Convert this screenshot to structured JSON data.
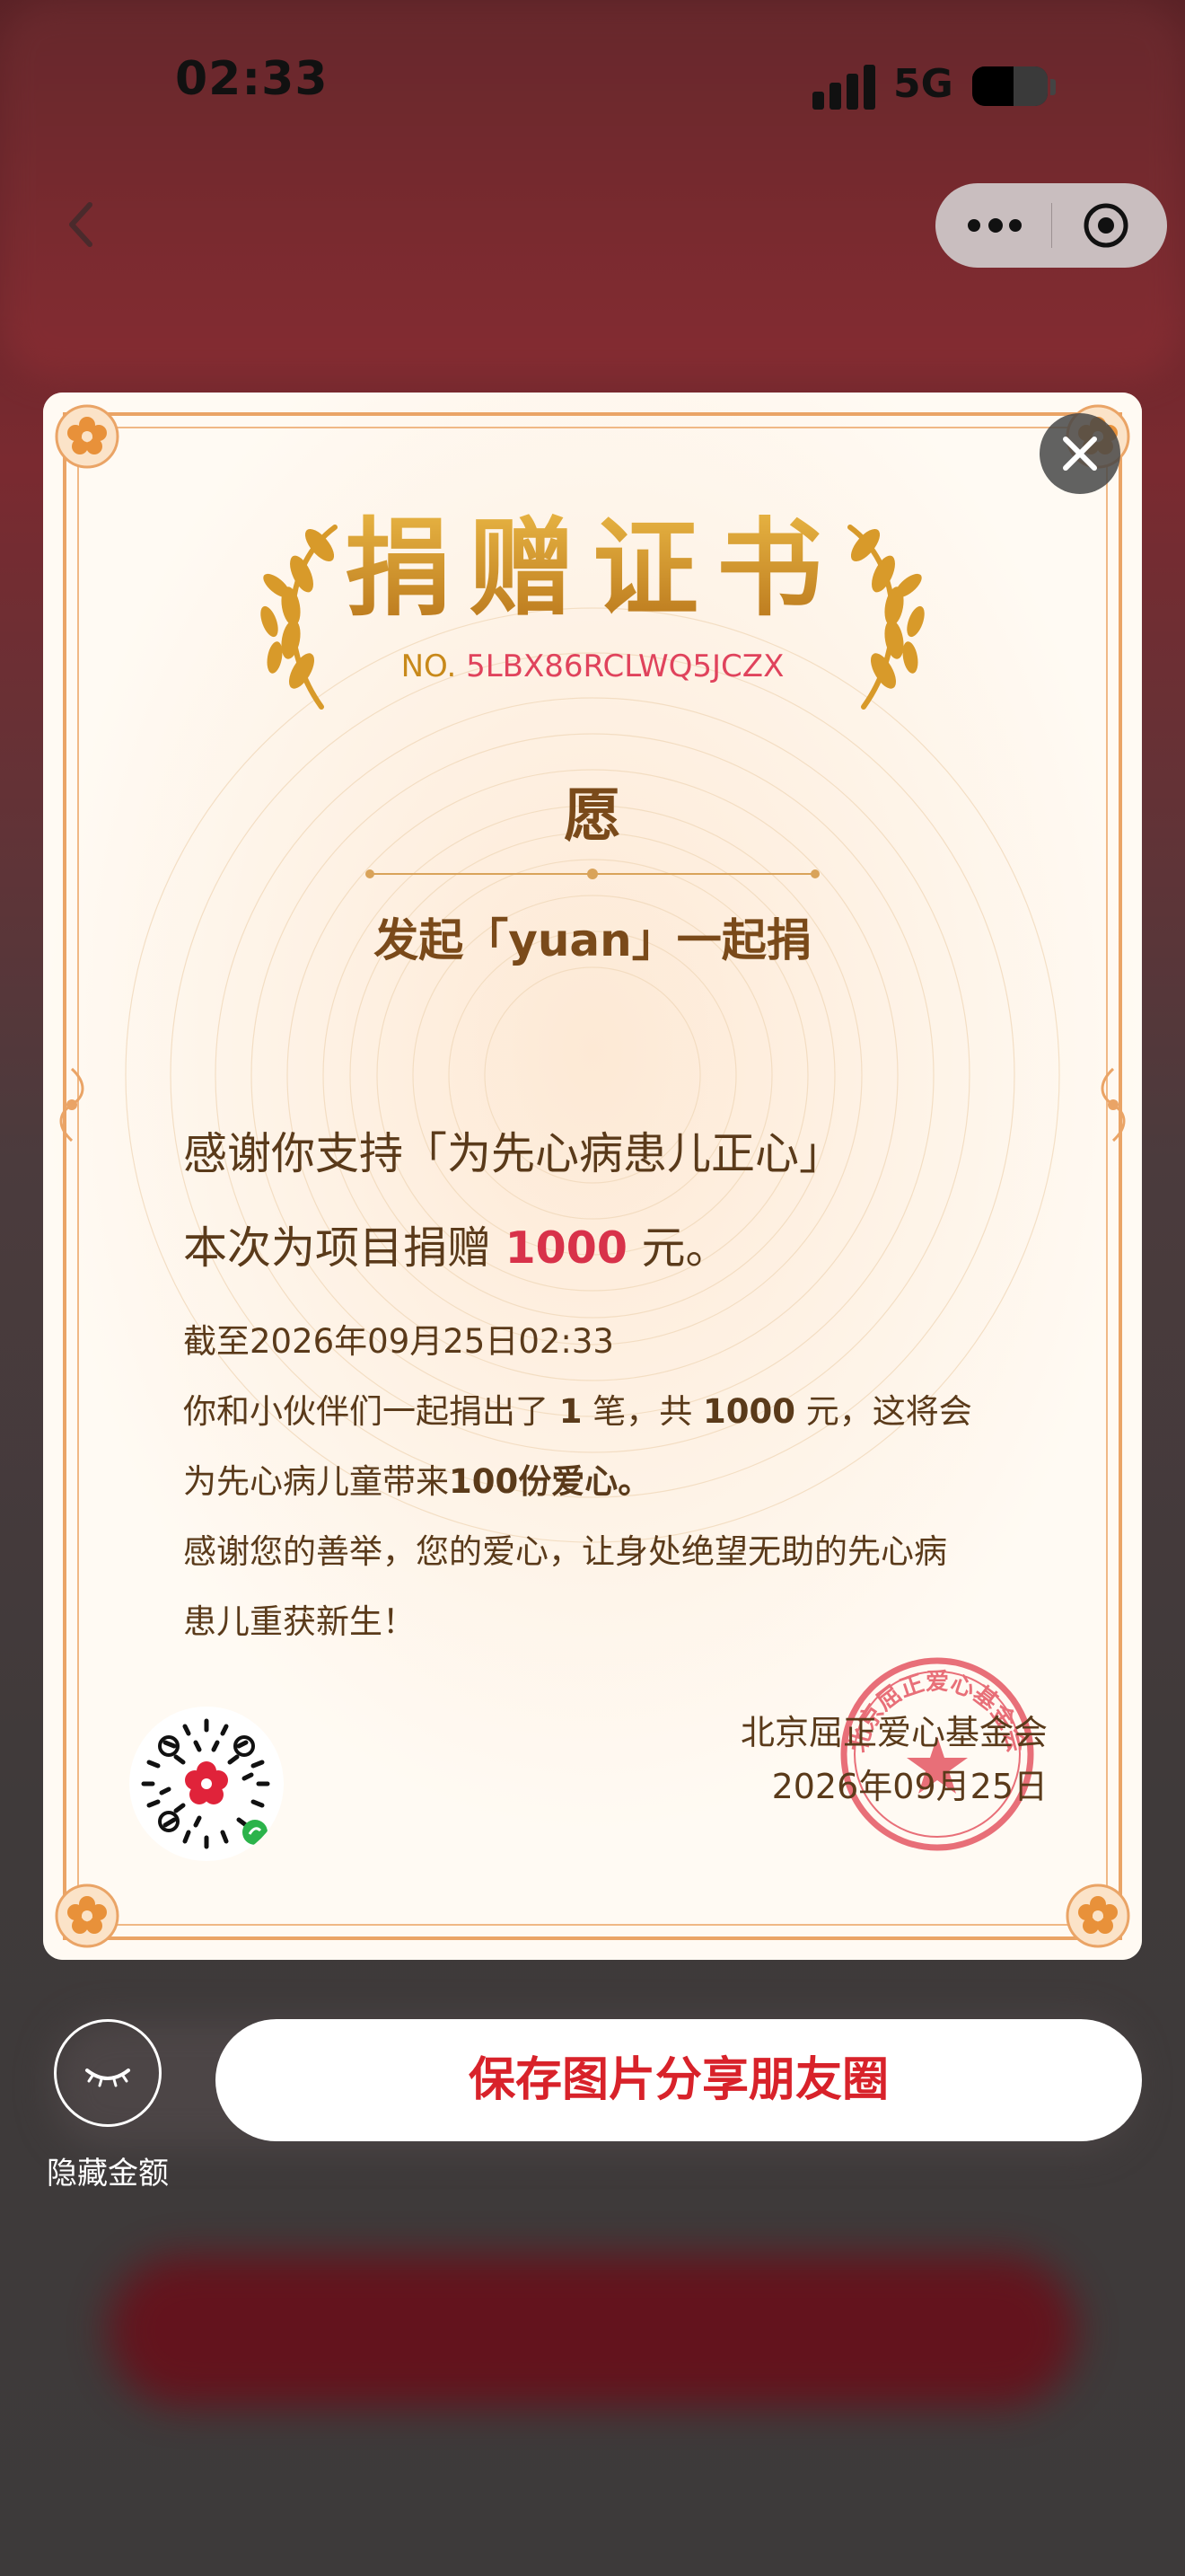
{
  "status_bar": {
    "time": "02:33",
    "network": "5G",
    "battery_level": 0.55
  },
  "nav": {
    "back_icon": "chevron-left-icon",
    "more_icon": "more-dots-icon",
    "close_app_icon": "target-icon"
  },
  "certificate": {
    "title": "捐赠证书",
    "number_prefix": "NO. ",
    "number": "5LBX86RCLWQ5JCZX",
    "yuan_char": "愿",
    "initiator": "发起「yuan」一起捐",
    "thanks_line1": "感谢你支持「为先心病患儿正心」",
    "thanks_line2_prefix": "本次为项目捐赠 ",
    "amount": "1000",
    "thanks_line2_suffix": " 元。",
    "as_of": "截至2026年09月25日02:33",
    "detail_line2_a": "你和小伙伴们一起捐出了 ",
    "count": "1",
    "detail_line2_b": " 笔，共 ",
    "total": "1000",
    "detail_line2_c": " 元，这将会",
    "detail_line3_a": "为先心病儿童带来",
    "hearts": "100份爱心。",
    "detail_line4": "感谢您的善举，您的爱心，让身处绝望无助的先心病",
    "detail_line5": "患儿重获新生！",
    "org_name": "北京屈正爱心基金会",
    "org_date": "2026年09月25日",
    "seal_text": "北京屈正爱心基金会",
    "colors": {
      "gold": "#c8891a",
      "red": "#d8324a",
      "brown": "#5a3a1a",
      "border": "#eaa466"
    }
  },
  "actions": {
    "hide_label": "隐藏金额",
    "save_label": "保存图片分享朋友圈"
  }
}
